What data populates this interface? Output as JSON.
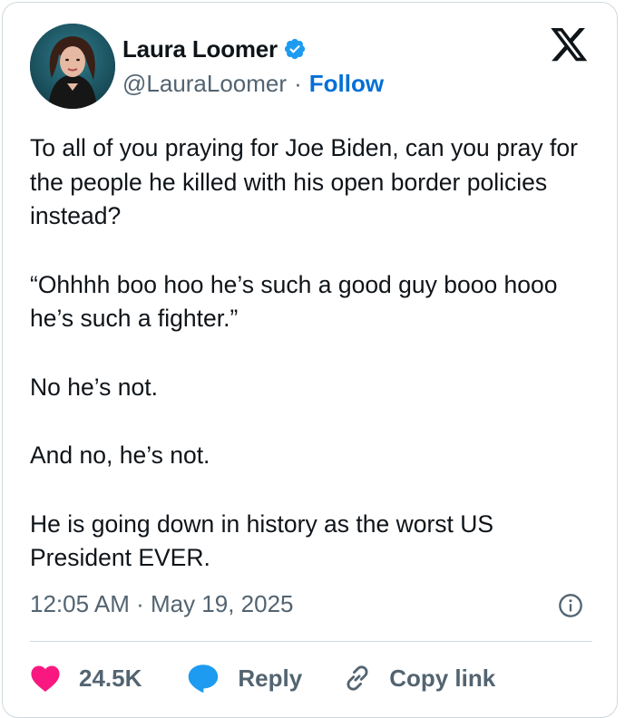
{
  "author": {
    "name": "Laura Loomer",
    "handle": "@LauraLoomer",
    "separator": "·",
    "follow_label": "Follow"
  },
  "tweet": {
    "paragraphs": [
      "To all of you praying for Joe Biden, can you pray for the people he killed with his open border policies instead?",
      "“Ohhhh boo hoo he’s such a good guy booo hooo he’s such a fighter.”",
      "No he’s not.",
      "And no, he’s not.",
      "He is going down in history as the worst US President EVER."
    ],
    "timestamp": "12:05 AM · May 19, 2025"
  },
  "actions": {
    "like_count": "24.5K",
    "reply_label": "Reply",
    "copy_link_label": "Copy link"
  },
  "icons": {
    "verified": "verified-badge-icon",
    "platform": "x-logo-icon",
    "info": "info-icon",
    "like": "heart-icon",
    "reply": "speech-bubble-icon",
    "copy": "link-icon"
  },
  "colors": {
    "accent_blue": "#006fd6",
    "verified_blue": "#1d9bf0",
    "heart_pink": "#f91880",
    "muted_text": "#536471",
    "primary_text": "#0f1419",
    "border": "#cfd9de"
  }
}
